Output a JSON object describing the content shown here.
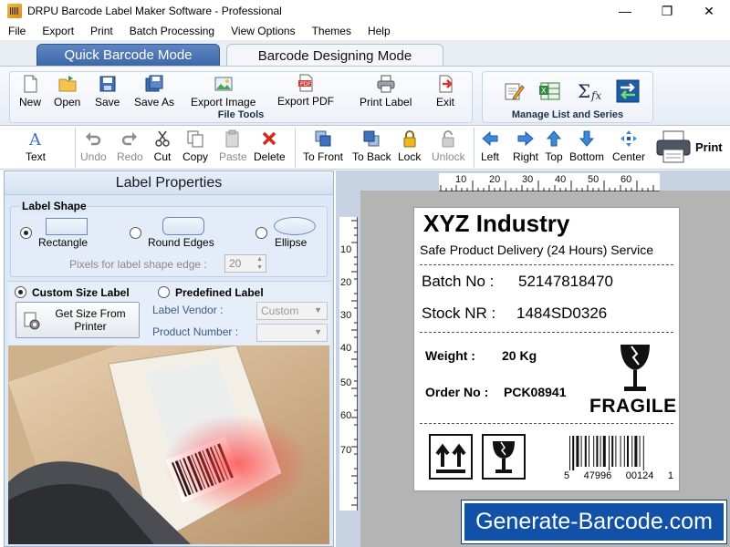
{
  "window": {
    "title": "DRPU Barcode Label Maker Software - Professional"
  },
  "menu": [
    "File",
    "Export",
    "Print",
    "Batch Processing",
    "View Options",
    "Themes",
    "Help"
  ],
  "modes": {
    "active": "Quick Barcode Mode",
    "inactive": "Barcode Designing Mode"
  },
  "ribbon": {
    "file_tools": {
      "label": "File Tools",
      "buttons": [
        "New",
        "Open",
        "Save",
        "Save As",
        "Export Image",
        "Export PDF",
        "Print Label",
        "Exit"
      ]
    },
    "manage": {
      "label": "Manage List and Series"
    }
  },
  "toolbar": {
    "text": "Text",
    "edit": [
      "Undo",
      "Redo",
      "Cut",
      "Copy",
      "Paste",
      "Delete"
    ],
    "arrange": [
      "To Front",
      "To Back",
      "Lock",
      "Unlock"
    ],
    "align": [
      "Left",
      "Right",
      "Top",
      "Bottom",
      "Center"
    ],
    "print": "Print"
  },
  "label_properties": {
    "title": "Label Properties",
    "shape_title": "Label Shape",
    "shapes": [
      "Rectangle",
      "Round Edges",
      "Ellipse"
    ],
    "pixels_label": "Pixels for label shape edge :",
    "pixels_value": "20",
    "custom_size": "Custom Size Label",
    "predefined": "Predefined Label",
    "get_size_btn": "Get Size From Printer",
    "vendor_label": "Label Vendor :",
    "vendor_value": "Custom",
    "product_label": "Product Number :",
    "product_value": ""
  },
  "ruler": {
    "top": [
      "10",
      "20",
      "30",
      "40",
      "50",
      "60"
    ],
    "left": [
      "10",
      "20",
      "30",
      "40",
      "50",
      "60",
      "70"
    ]
  },
  "label": {
    "company": "XYZ Industry",
    "tagline": "Safe Product Delivery (24 Hours) Service",
    "batch_label": "Batch No :",
    "batch_value": "52147818470",
    "stock_label": "Stock NR :",
    "stock_value": "1484SD0326",
    "weight_label": "Weight :",
    "weight_value": "20 Kg",
    "order_label": "Order No :",
    "order_value": "PCK08941",
    "fragile": "FRAGILE",
    "barcode_digits": [
      "5",
      "47996",
      "00124",
      "1"
    ]
  },
  "watermark": "Generate-Barcode.com"
}
